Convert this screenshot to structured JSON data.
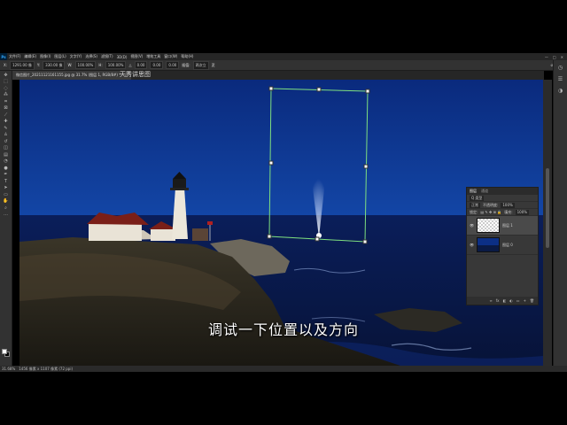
{
  "app": {
    "logo": "Ps"
  },
  "menu": [
    "文件(F)",
    "编辑(E)",
    "图像(I)",
    "图层(L)",
    "文字(Y)",
    "选择(S)",
    "滤镜(T)",
    "3D(D)",
    "视图(V)",
    "增效工具",
    "窗口(W)",
    "帮助(H)"
  ],
  "window_controls": [
    "—",
    "□",
    "✕"
  ],
  "options": {
    "x_label": "X:",
    "x_value": "1291.00 像",
    "y_label": "Y:",
    "y_value": "330.00 像",
    "w_label": "W:",
    "w_value": "100.00%",
    "h_label": "H:",
    "h_value": "100.00%",
    "angle_label": "△",
    "angle_value": "0.00",
    "h_skew": "0.00",
    "v_skew": "0.00",
    "interp_label": "插值:",
    "interp_value": "两次立",
    "warp_icon": "変",
    "cancel_icon": "⊘",
    "commit_icon": "✓"
  },
  "tab": {
    "label": "微信图片_20211121161155.jpg @ 31.7% (图层 1, RGB/8#) *",
    "close": "×"
  },
  "overlay_title": "天秀讲思图",
  "status": {
    "zoom": "31.68%",
    "doc": "1456 像素 x 1107 像素 (72 ppi)"
  },
  "layers_panel": {
    "tabs": [
      "图层",
      "通道"
    ],
    "kind_label": "Q 类型",
    "blend": "正常",
    "opacity_label": "不透明度:",
    "opacity": "100%",
    "lock_label": "锁定:",
    "fill_label": "填充:",
    "fill": "100%",
    "layers": [
      {
        "name": "图层 1",
        "selected": true
      },
      {
        "name": "图层 0",
        "selected": false
      }
    ],
    "footer_icons": [
      "∞",
      "fx",
      "◧",
      "◐",
      "▭",
      "+",
      "🗑"
    ]
  },
  "subtitle": "调试一下位置以及方向",
  "colors": {
    "sky": "#0c2f85",
    "sea": "#0a1a45",
    "transform_box": "#7fe07f"
  }
}
